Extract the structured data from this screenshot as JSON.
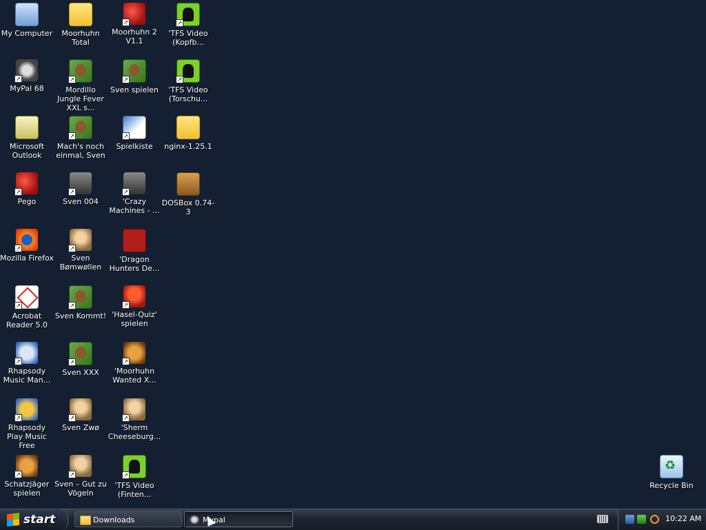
{
  "desktop": {
    "icons": [
      {
        "label": "My Computer",
        "icon": "computer-icon",
        "shortcut": false
      },
      {
        "label": "MyPal 68",
        "icon": "raccoon-icon",
        "shortcut": true
      },
      {
        "label": "Microsoft Outlook",
        "icon": "outlook-icon",
        "shortcut": false
      },
      {
        "label": "Pego",
        "icon": "red-ball-icon",
        "shortcut": true
      },
      {
        "label": "Mozilla Firefox",
        "icon": "firefox-icon",
        "shortcut": true
      },
      {
        "label": "Acrobat Reader 5.0",
        "icon": "acrobat-icon",
        "shortcut": true
      },
      {
        "label": "Rhapsody Music Man...",
        "icon": "rhapsody-icon",
        "shortcut": true
      },
      {
        "label": "Rhapsody Play Music Free",
        "icon": "rhapsody-play-icon",
        "shortcut": true
      },
      {
        "label": "Schatzjäger spielen",
        "icon": "treasure-icon",
        "shortcut": true
      },
      {
        "label": "Moorhuhn Total",
        "icon": "folder-icon",
        "shortcut": false
      },
      {
        "label": "Mordillo Jungle Fever XXL s...",
        "icon": "jungle-icon",
        "shortcut": true
      },
      {
        "label": "Mach's noch einmal, Sven",
        "icon": "sven-icon",
        "shortcut": true
      },
      {
        "label": "Sven 004",
        "icon": "robot-icon",
        "shortcut": true
      },
      {
        "label": "Sven Bømwøllen",
        "icon": "sheep-icon",
        "shortcut": true
      },
      {
        "label": "Sven Kommt!",
        "icon": "sven-icon",
        "shortcut": true
      },
      {
        "label": "Sven XXX",
        "icon": "sven-icon",
        "shortcut": true
      },
      {
        "label": "Sven Zwø",
        "icon": "sven-icon",
        "shortcut": true
      },
      {
        "label": "Sven – Gut zu Vögeln",
        "icon": "sven-icon",
        "shortcut": true
      },
      {
        "label": "Moorhuhn 2 V1.1",
        "icon": "moorhuhn-icon",
        "shortcut": true
      },
      {
        "label": "Sven spielen",
        "icon": "sven-icon",
        "shortcut": true
      },
      {
        "label": "Spielkiste",
        "icon": "dice-icon",
        "shortcut": true
      },
      {
        "label": "'Crazy Machines - ...",
        "icon": "machine-icon",
        "shortcut": true
      },
      {
        "label": "'Dragon Hunters De...",
        "icon": "dragon-icon",
        "shortcut": false
      },
      {
        "label": "'Hasel-Quiz' spielen",
        "icon": "hasel-icon",
        "shortcut": true
      },
      {
        "label": "'Moorhuhn Wanted X...",
        "icon": "moorhuhn-icon",
        "shortcut": true
      },
      {
        "label": "'Sherm Cheeseburg...",
        "icon": "sherm-icon",
        "shortcut": true
      },
      {
        "label": "'TFS Video (Finten...",
        "icon": "tfs-icon",
        "shortcut": true
      },
      {
        "label": "'TFS Video (Kopfb...",
        "icon": "tfs-icon",
        "shortcut": true
      },
      {
        "label": "'TFS Video (Torschu...",
        "icon": "tfs-icon",
        "shortcut": true
      },
      {
        "label": "nginx-1.25.1",
        "icon": "folder-icon",
        "shortcut": false
      },
      {
        "label": "DOSBox 0.74-3",
        "icon": "dosbox-icon",
        "shortcut": false
      },
      {
        "label": "Recycle Bin",
        "icon": "recycle-bin-icon",
        "shortcut": false
      }
    ]
  },
  "taskbar": {
    "start_label": "start",
    "tasks": [
      {
        "label": "Downloads",
        "icon": "folder-icon",
        "active": false
      },
      {
        "label": "Mypal",
        "icon": "mypal-icon",
        "active": true
      }
    ],
    "clock": "10:22 AM"
  }
}
